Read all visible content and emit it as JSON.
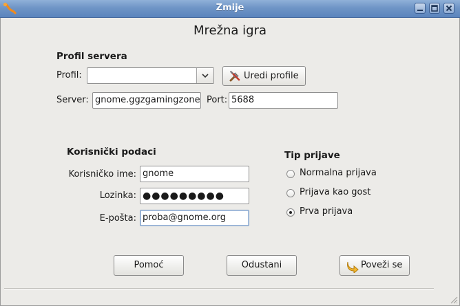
{
  "window": {
    "title": "Zmije"
  },
  "dialog": {
    "heading": "Mrežna igra"
  },
  "server_profile": {
    "section_title": "Profil servera",
    "profile_label": "Profil:",
    "profile_value": "",
    "edit_profiles_label": "Uredi profile",
    "server_label": "Server:",
    "server_value": "gnome.ggzgamingzone",
    "port_label": "Port:",
    "port_value": "5688"
  },
  "user_data": {
    "section_title": "Korisnički podaci",
    "username_label": "Korisničko ime:",
    "username_value": "gnome",
    "password_label": "Lozinka:",
    "password_value": "●●●●●●●●●",
    "email_label": "E-pošta:",
    "email_value": "proba@gnome.org"
  },
  "login_type": {
    "section_title": "Tip prijave",
    "options": [
      {
        "label": "Normalna prijava",
        "selected": false
      },
      {
        "label": "Prijava kao gost",
        "selected": false
      },
      {
        "label": "Prva prijava",
        "selected": true
      }
    ]
  },
  "buttons": {
    "help_label": "Pomoć",
    "cancel_label": "Odustani",
    "connect_label": "Poveži se"
  }
}
